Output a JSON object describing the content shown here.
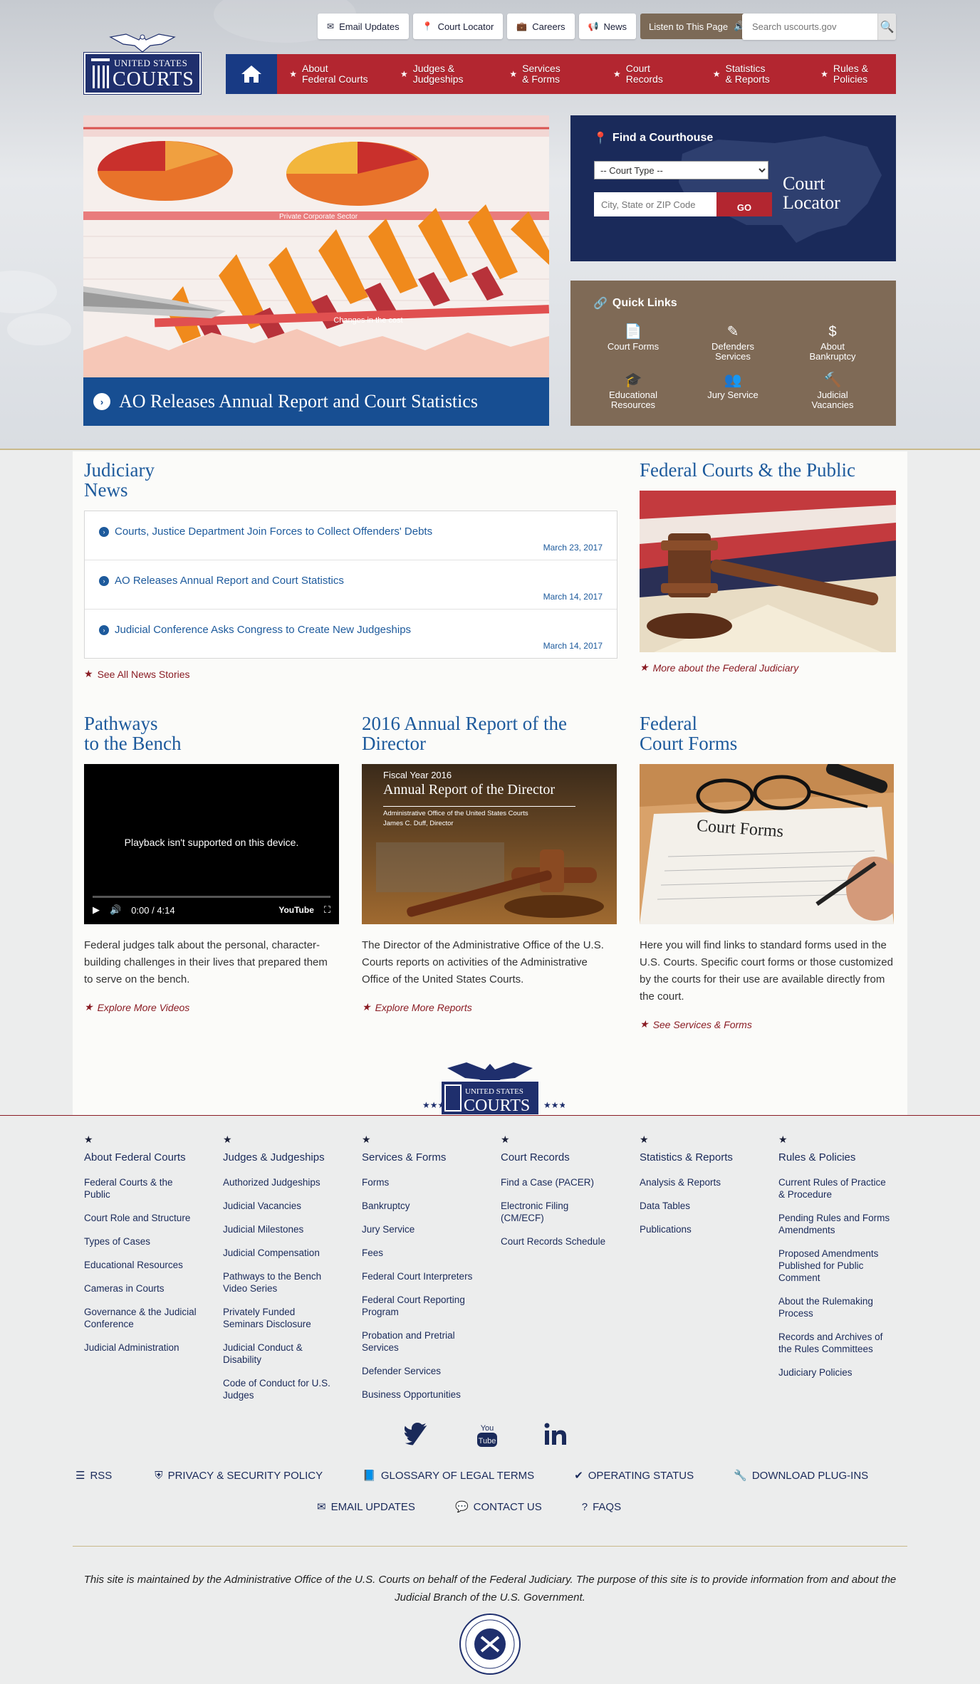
{
  "utility": {
    "email_updates": "Email Updates",
    "court_locator": "Court Locator",
    "careers": "Careers",
    "news": "News",
    "listen": "Listen to This Page",
    "search_placeholder": "Search uscourts.gov"
  },
  "logo": {
    "line1": "UNITED STATES",
    "line2": "COURTS"
  },
  "nav": {
    "items": [
      {
        "label": "About\nFederal Courts"
      },
      {
        "label": "Judges &\nJudgeships"
      },
      {
        "label": "Services\n& Forms"
      },
      {
        "label": "Court\nRecords"
      },
      {
        "label": "Statistics\n& Reports"
      },
      {
        "label": "Rules &\nPolicies"
      }
    ]
  },
  "feature": {
    "caption": "AO Releases Annual Report and Court Statistics",
    "chart_banner1": "Private Corporate Sector",
    "chart_banner2": "Changes in the cost"
  },
  "locator": {
    "heading": "Find a Courthouse",
    "select_value": "-- Court Type --",
    "zip_placeholder": "City, State or ZIP Code",
    "go": "GO",
    "title": "Court\nLocator"
  },
  "quick_links": {
    "heading": "Quick Links",
    "items": [
      {
        "label": "Court Forms"
      },
      {
        "label": "Defenders\nServices"
      },
      {
        "label": "About\nBankruptcy"
      },
      {
        "label": "Educational\nResources"
      },
      {
        "label": "Jury Service"
      },
      {
        "label": "Judicial\nVacancies"
      }
    ]
  },
  "judiciary_news": {
    "title": "Judiciary\nNews",
    "items": [
      {
        "title": "Courts, Justice Department Join Forces to Collect Offenders' Debts",
        "date": "March 23, 2017"
      },
      {
        "title": "AO Releases Annual Report and Court Statistics",
        "date": "March 14, 2017"
      },
      {
        "title": "Judicial Conference Asks Congress to Create New Judgeships",
        "date": "March 14, 2017"
      }
    ],
    "see_all": "See All News Stories"
  },
  "public": {
    "title": "Federal Courts & the Public",
    "more": "More about the Federal Judiciary"
  },
  "pathways": {
    "title": "Pathways\nto the Bench",
    "video_message": "Playback isn't supported on this device.",
    "video_time": "0:00 / 4:14",
    "video_brand": "YouTube",
    "text": "Federal judges talk about the personal, character-building challenges in their lives that prepared them to serve on the bench.",
    "more": "Explore More Videos"
  },
  "annual": {
    "title": "2016 Annual Report of the\nDirector",
    "img_fy": "Fiscal Year 2016",
    "img_title": "Annual Report of the Director",
    "img_sub1": "Administrative Office of the United States Courts",
    "img_sub2": "James C. Duff, Director",
    "text": "The Director of the Administrative Office of the U.S. Courts reports on activities of the Administrative Office of the United States Courts.",
    "more": "Explore More Reports"
  },
  "forms": {
    "title": "Federal\nCourt Forms",
    "img_label": "Court Forms",
    "text": "Here you will find links to standard forms used in the U.S. Courts. Specific court forms or those customized by the courts for their use are available directly from the court.",
    "more": "See Services & Forms"
  },
  "footer": {
    "columns": [
      {
        "heading": "About Federal Courts",
        "links": [
          "Federal Courts & the\nPublic",
          "Court Role and Structure",
          "Types of Cases",
          "Educational Resources",
          "Cameras in Courts",
          "Governance & the Judicial\nConference",
          "Judicial Administration"
        ]
      },
      {
        "heading": "Judges & Judgeships",
        "links": [
          "Authorized Judgeships",
          "Judicial Vacancies",
          "Judicial Milestones",
          "Judicial Compensation",
          "Pathways to the Bench\nVideo Series",
          "Privately Funded\nSeminars Disclosure",
          "Judicial Conduct &\nDisability",
          "Code of Conduct for U.S.\nJudges"
        ]
      },
      {
        "heading": "Services & Forms",
        "links": [
          "Forms",
          "Bankruptcy",
          "Jury Service",
          "Fees",
          "Federal Court Interpreters",
          "Federal Court Reporting\nProgram",
          "Probation and Pretrial\nServices",
          "Defender Services",
          "Business Opportunities"
        ]
      },
      {
        "heading": "Court Records",
        "links": [
          "Find a Case (PACER)",
          "Electronic Filing\n(CM/ECF)",
          "Court Records Schedule"
        ]
      },
      {
        "heading": "Statistics & Reports",
        "links": [
          "Analysis & Reports",
          "Data Tables",
          "Publications"
        ]
      },
      {
        "heading": "Rules & Policies",
        "links": [
          "Current Rules of Practice\n& Procedure",
          "Pending Rules and Forms\nAmendments",
          "Proposed Amendments\nPublished for Public\nComment",
          "About the Rulemaking\nProcess",
          "Records and Archives of\nthe Rules Committees",
          "Judiciary Policies"
        ]
      }
    ],
    "bottom_row1": [
      "RSS",
      "PRIVACY & SECURITY POLICY",
      "GLOSSARY OF LEGAL TERMS",
      "OPERATING STATUS",
      "DOWNLOAD PLUG-INS"
    ],
    "bottom_row2": [
      "EMAIL UPDATES",
      "CONTACT US",
      "FAQS"
    ],
    "disclaimer": "This site is maintained by the Administrative Office of the U.S. Courts on behalf of the Federal Judiciary. The purpose of this site is to provide information from and about the Judicial Branch of the U.S. Government."
  },
  "colors": {
    "nav_red": "#b32630",
    "navy": "#1a2a5a",
    "link_blue": "#1d5a9c",
    "brown": "#7f6a56",
    "accent_red": "#8a1c24"
  }
}
